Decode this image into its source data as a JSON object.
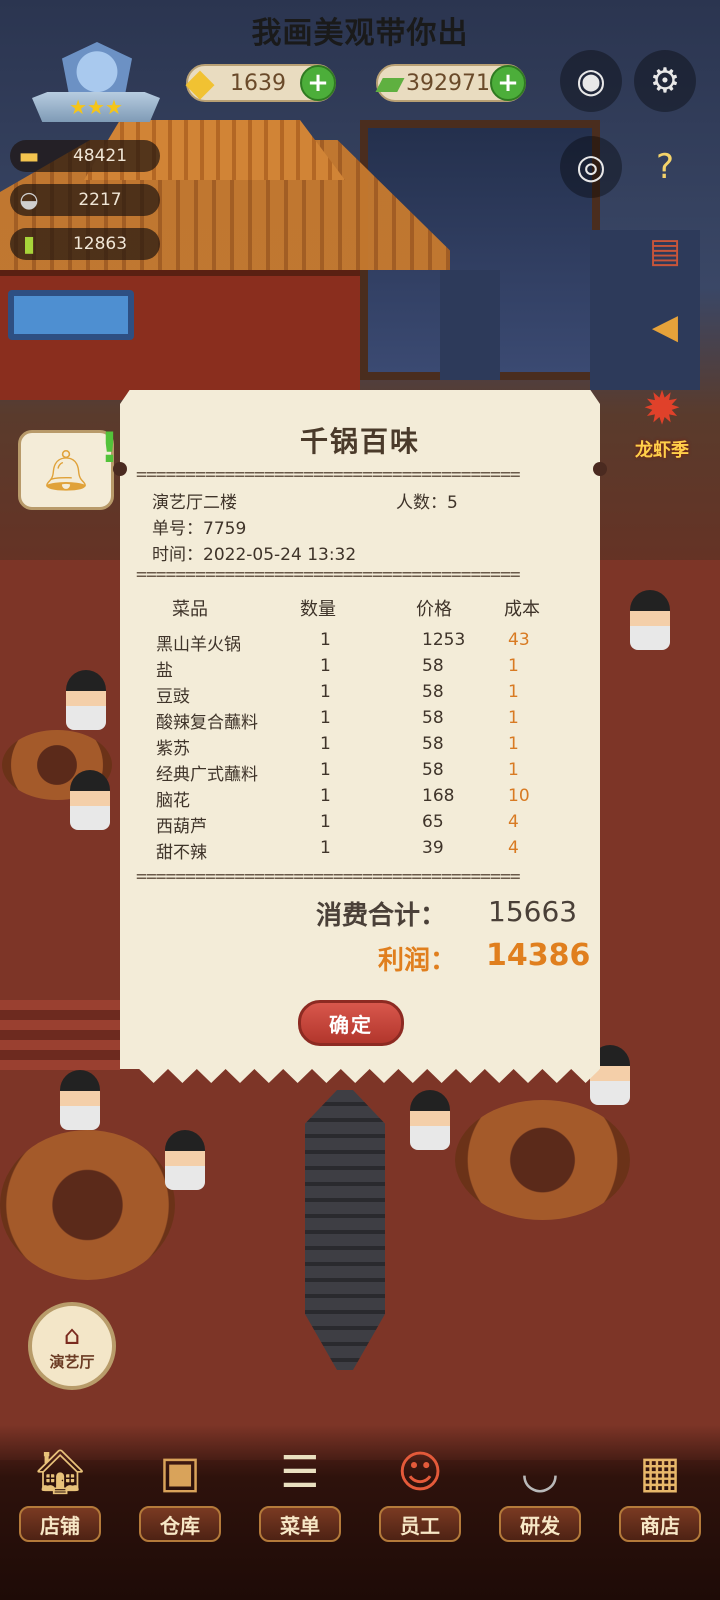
{
  "top_title": "我画美观带你出",
  "hud": {
    "level_stars": "★★★",
    "gold": {
      "value": "1639",
      "icon": "gold-ingot-icon",
      "plus": "+"
    },
    "cash": {
      "value": "392971",
      "icon": "cash-stack-icon",
      "plus": "+"
    },
    "stats": [
      {
        "icon": "dish-cover-icon",
        "value": "48421"
      },
      {
        "icon": "cloche-icon",
        "value": "2217"
      },
      {
        "icon": "ticket-icon",
        "value": "12863"
      }
    ]
  },
  "event_badge": "龙虾季",
  "receipt": {
    "title": "千锅百味",
    "divider": "=======================================",
    "hall": "演艺厅二楼",
    "guests": "人数：5",
    "order_no": "单号：7759",
    "time": "时间：2022-05-24 13:32",
    "headers": {
      "dish": "菜品",
      "qty": "数量",
      "price": "价格",
      "cost": "成本"
    },
    "items": [
      {
        "dish": "黑山羊火锅",
        "qty": "1",
        "price": "1253",
        "cost": "43"
      },
      {
        "dish": "盐",
        "qty": "1",
        "price": "58",
        "cost": "1"
      },
      {
        "dish": "豆豉",
        "qty": "1",
        "price": "58",
        "cost": "1"
      },
      {
        "dish": "酸辣复合蘸料",
        "qty": "1",
        "price": "58",
        "cost": "1"
      },
      {
        "dish": "紫苏",
        "qty": "1",
        "price": "58",
        "cost": "1"
      },
      {
        "dish": "经典广式蘸料",
        "qty": "1",
        "price": "58",
        "cost": "1"
      },
      {
        "dish": "脑花",
        "qty": "1",
        "price": "168",
        "cost": "10"
      },
      {
        "dish": "西葫芦",
        "qty": "1",
        "price": "65",
        "cost": "4"
      },
      {
        "dish": "甜不辣",
        "qty": "1",
        "price": "39",
        "cost": "4"
      }
    ],
    "total_label": "消费合计：",
    "total_value": "15663",
    "profit_label": "利润：",
    "profit_value": "14386",
    "confirm": "确定"
  },
  "floor_button": "演艺厅",
  "nav": [
    {
      "label": "店铺",
      "icon": "shop-icon"
    },
    {
      "label": "仓库",
      "icon": "warehouse-icon"
    },
    {
      "label": "菜单",
      "icon": "menu-clipboard-icon"
    },
    {
      "label": "员工",
      "icon": "staff-icon"
    },
    {
      "label": "研发",
      "icon": "research-pot-icon"
    },
    {
      "label": "商店",
      "icon": "store-icon"
    }
  ]
}
